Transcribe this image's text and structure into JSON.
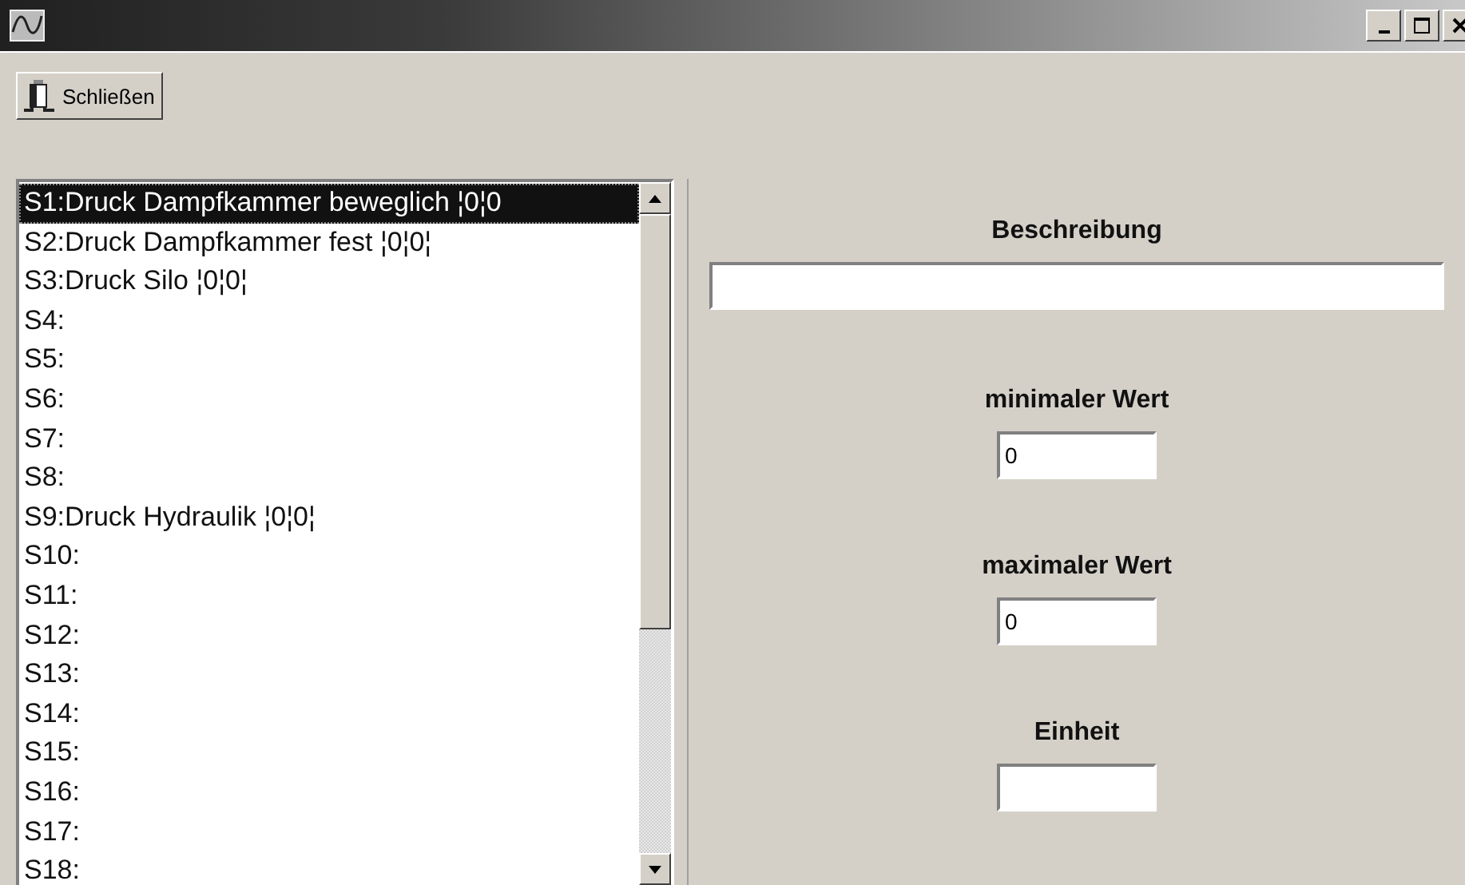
{
  "toolbar": {
    "close_button": {
      "label": "Schließen"
    }
  },
  "list": {
    "items": [
      {
        "text": "S1:Druck Dampfkammer beweglich ¦0¦0",
        "selected": true
      },
      {
        "text": "S2:Druck Dampfkammer fest ¦0¦0¦",
        "selected": false
      },
      {
        "text": "S3:Druck Silo ¦0¦0¦",
        "selected": false
      },
      {
        "text": "S4:",
        "selected": false
      },
      {
        "text": "S5:",
        "selected": false
      },
      {
        "text": "S6:",
        "selected": false
      },
      {
        "text": "S7:",
        "selected": false
      },
      {
        "text": "S8:",
        "selected": false
      },
      {
        "text": "S9:Druck Hydraulik ¦0¦0¦",
        "selected": false
      },
      {
        "text": "S10:",
        "selected": false
      },
      {
        "text": "S11:",
        "selected": false
      },
      {
        "text": "S12:",
        "selected": false
      },
      {
        "text": "S13:",
        "selected": false
      },
      {
        "text": "S14:",
        "selected": false
      },
      {
        "text": "S15:",
        "selected": false
      },
      {
        "text": "S16:",
        "selected": false
      },
      {
        "text": "S17:",
        "selected": false
      },
      {
        "text": "S18:",
        "selected": false
      }
    ]
  },
  "form": {
    "fields": [
      {
        "label": "Beschreibung",
        "kind": "wide"
      },
      {
        "label": "minimaler Wert",
        "value": "0",
        "kind": "small"
      },
      {
        "label": "maximaler Wert",
        "value": "0",
        "kind": "small"
      },
      {
        "label": "Einheit",
        "kind": "small"
      }
    ]
  }
}
